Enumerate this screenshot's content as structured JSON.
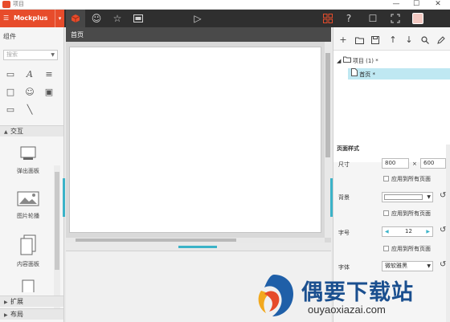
{
  "window": {
    "title": "项目",
    "controls": [
      "—",
      "☐",
      "✕"
    ]
  },
  "toolbar": {
    "brand": "Mockplus",
    "menu_glyph": "☰",
    "caret": "▾"
  },
  "left_panel": {
    "title": "组件",
    "search_placeholder": "搜索",
    "sections": [
      {
        "label": "交互",
        "expanded": true
      },
      {
        "label": "扩展",
        "expanded": false
      },
      {
        "label": "布局",
        "expanded": false
      }
    ],
    "components": [
      {
        "label": "弹出面板"
      },
      {
        "label": "图片轮播"
      },
      {
        "label": "内容面板"
      }
    ]
  },
  "canvas": {
    "tab_label": "首页"
  },
  "right_panel": {
    "tree": {
      "root_label": "项目 (1)",
      "page_label": "首页"
    },
    "page_style_title": "页面样式",
    "size": {
      "label": "尺寸",
      "width": "800",
      "height": "600",
      "x": "×"
    },
    "apply_all": "应用到所有页面",
    "background": {
      "label": "背景",
      "color": "#ffffff"
    },
    "font_size": {
      "label": "字号",
      "value": "12"
    },
    "font": {
      "label": "字体",
      "value": "微软雅黑"
    }
  },
  "watermark": {
    "cn": "偶要下载站",
    "en": "ouyaoxiazai.com"
  },
  "colors": {
    "accent": "#e74c2b",
    "selection": "#bfe8f2",
    "toolbar": "#2f2f2f",
    "highlight": "#3bb3c8"
  }
}
